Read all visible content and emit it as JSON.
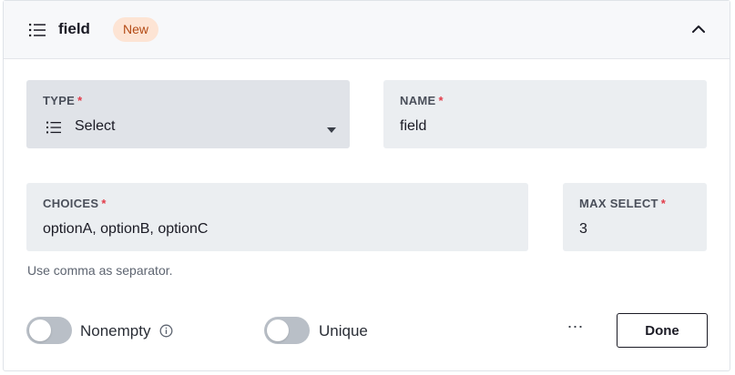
{
  "header": {
    "icon": "list-icon",
    "title": "field",
    "badge": "New",
    "collapse_icon": "chevron-up-icon"
  },
  "form": {
    "type": {
      "label": "TYPE",
      "required": "*",
      "icon": "list-icon",
      "value": "Select",
      "dropdown_icon": "caret-down-icon"
    },
    "name": {
      "label": "NAME",
      "required": "*",
      "value": "field"
    },
    "choices": {
      "label": "CHOICES",
      "required": "*",
      "value": "optionA, optionB, optionC",
      "hint": "Use comma as separator."
    },
    "max_select": {
      "label": "MAX SELECT",
      "required": "*",
      "value": "3"
    }
  },
  "footer": {
    "nonempty": {
      "label": "Nonempty",
      "on": false,
      "info_icon": "info-icon"
    },
    "unique": {
      "label": "Unique",
      "on": false
    },
    "more_label": "⋯",
    "done_label": "Done"
  },
  "colors": {
    "badge_bg": "#fde4d4",
    "badge_text": "#b34a14",
    "required": "#e23c4a",
    "field_bg": "#ebeef1",
    "toggle_off": "#b9bfc7"
  }
}
